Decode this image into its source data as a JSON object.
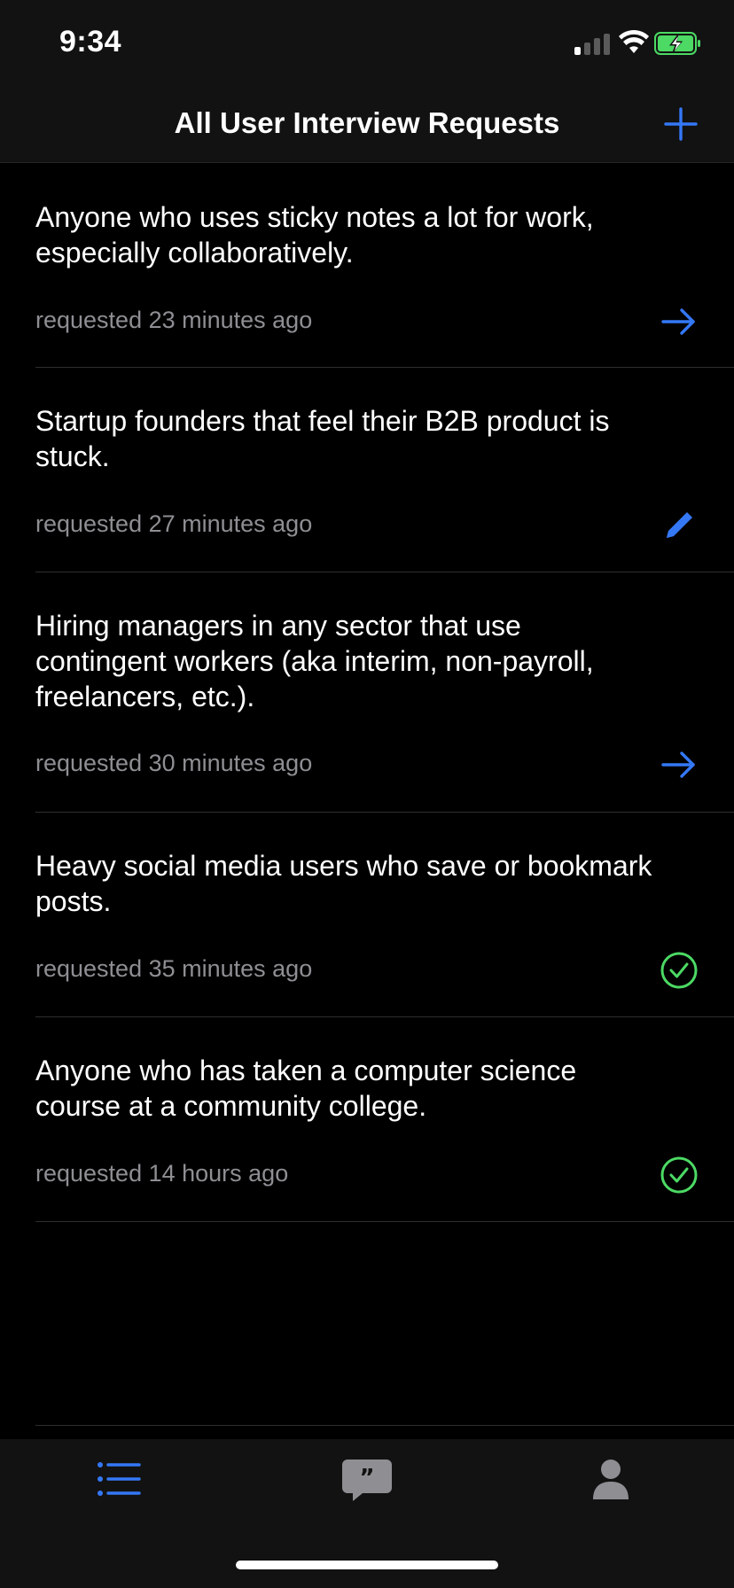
{
  "status_bar": {
    "time": "9:34"
  },
  "nav": {
    "title": "All User Interview Requests",
    "add_icon": "plus-icon"
  },
  "requests": [
    {
      "text": "Anyone who uses sticky notes a lot for work, especially collaboratively.",
      "time": "requested 23 minutes ago",
      "action_icon": "arrow-right-icon"
    },
    {
      "text": "Startup founders that feel their B2B product is stuck.",
      "time": "requested 27 minutes ago",
      "action_icon": "pencil-icon"
    },
    {
      "text": "Hiring managers in any sector that use contingent workers (aka interim, non-payroll, freelancers, etc.).",
      "time": "requested 30 minutes ago",
      "action_icon": "arrow-right-icon"
    },
    {
      "text": "Heavy social media users who save or bookmark posts.",
      "time": "requested 35 minutes ago",
      "action_icon": "check-circle-icon"
    },
    {
      "text": "Anyone who has taken a computer science course at a community college.",
      "time": "requested 14 hours ago",
      "action_icon": "check-circle-icon"
    }
  ],
  "tab_bar": {
    "tabs": [
      {
        "icon": "list-icon",
        "active": true
      },
      {
        "icon": "chat-quote-icon",
        "active": false
      },
      {
        "icon": "person-icon",
        "active": false
      }
    ]
  },
  "colors": {
    "accent": "#3478f6",
    "success": "#4cd964",
    "secondary_text": "#8e8e93",
    "battery": "#4cd964"
  }
}
